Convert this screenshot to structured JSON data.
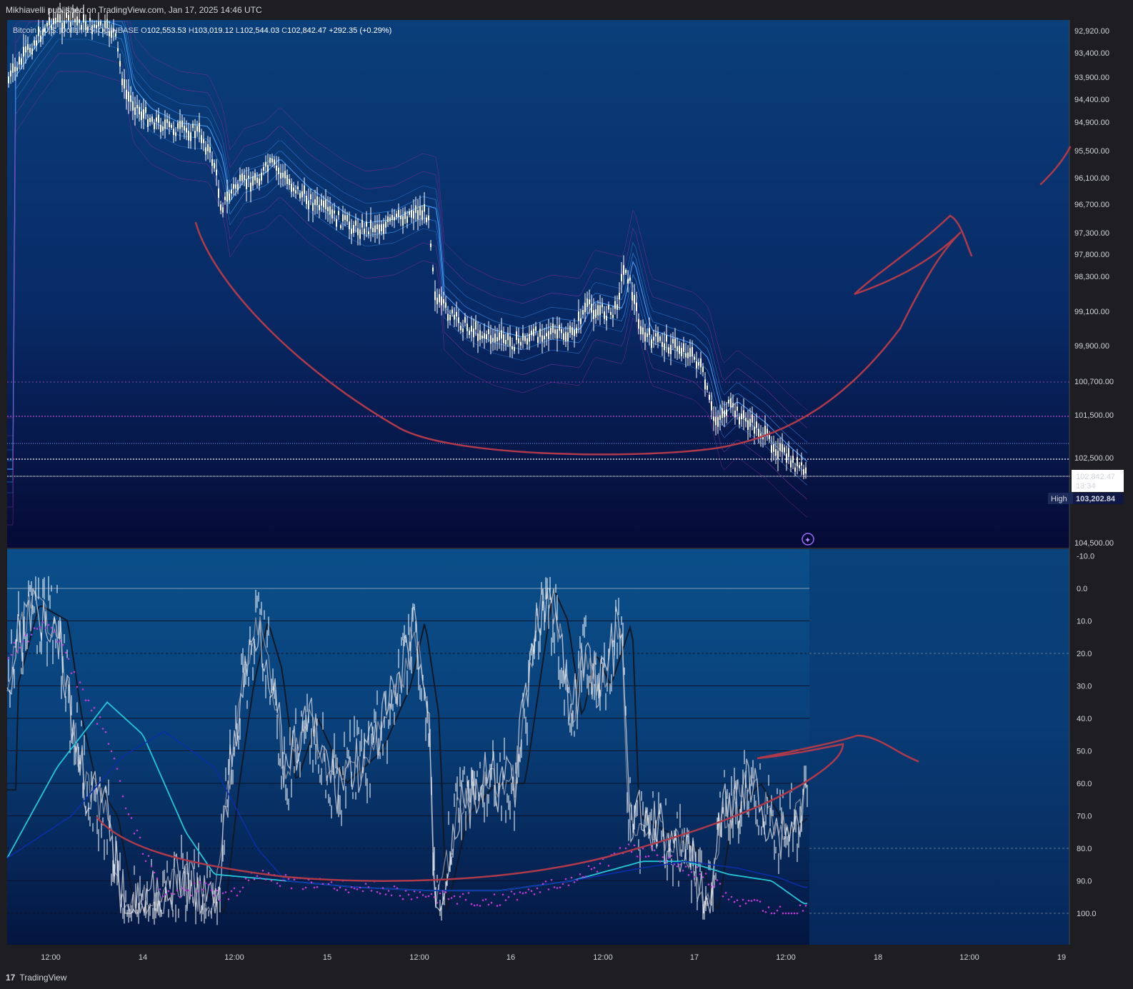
{
  "header": {
    "publisher": "Mikhiavelli published on TradingView.com, Jan 17, 2025 14:46 UTC"
  },
  "footer": {
    "brand": "TradingView",
    "logo_glyph": "17"
  },
  "chart_data": [
    {
      "type": "candlestick",
      "title": "Bitcoin / U.S. Dollar, 15, COINBASE",
      "ohlc": {
        "open_label": "O",
        "open": "102,553.53",
        "high_label": "H",
        "high": "103,019.12",
        "low_label": "L",
        "low": "102,544.03",
        "close_label": "C",
        "close": "102,842.47",
        "change": "+292.35 (+0.29%)"
      },
      "price_axis_scale": "inverted",
      "price_ticks": [
        "92,920.00",
        "93,400.00",
        "93,900.00",
        "94,400.00",
        "94,900.00",
        "95,500.00",
        "96,100.00",
        "96,700.00",
        "97,300.00",
        "97,800.00",
        "98,300.00",
        "99,100.00",
        "99,900.00",
        "100,700.00",
        "101,500.00",
        "102,500.00",
        "104,500.00"
      ],
      "current_price": {
        "value": "102,842.47",
        "countdown": "13:34"
      },
      "high_marker": {
        "label": "High",
        "value": "103,202.84"
      },
      "x_ticks": [
        "12:00",
        "14",
        "12:00",
        "15",
        "12:00",
        "16",
        "12:00",
        "17",
        "12:00",
        "18",
        "12:00",
        "19"
      ],
      "colors": {
        "candle": "#ffffff",
        "band": "#2f7fd8",
        "outer_band": "#8a2a9a",
        "drawing": "#b0394a",
        "background_top": "#0a3f7a",
        "background_bottom": "#050a35"
      }
    },
    {
      "type": "line",
      "title": "",
      "y_axis_scale": "inverted",
      "y_ticks": [
        "-10.0",
        "0.0",
        "10.0",
        "20.0",
        "30.0",
        "40.0",
        "50.0",
        "60.0",
        "70.0",
        "80.0",
        "90.0",
        "100.0"
      ],
      "ylim": [
        -10,
        110
      ],
      "colors": {
        "oscillator": "#e8e8f0",
        "slow": "#111827",
        "cyan": "#22c8d8",
        "navy": "#0b2ea8",
        "dots": "#c23ad8",
        "drawing": "#b0394a"
      }
    }
  ]
}
